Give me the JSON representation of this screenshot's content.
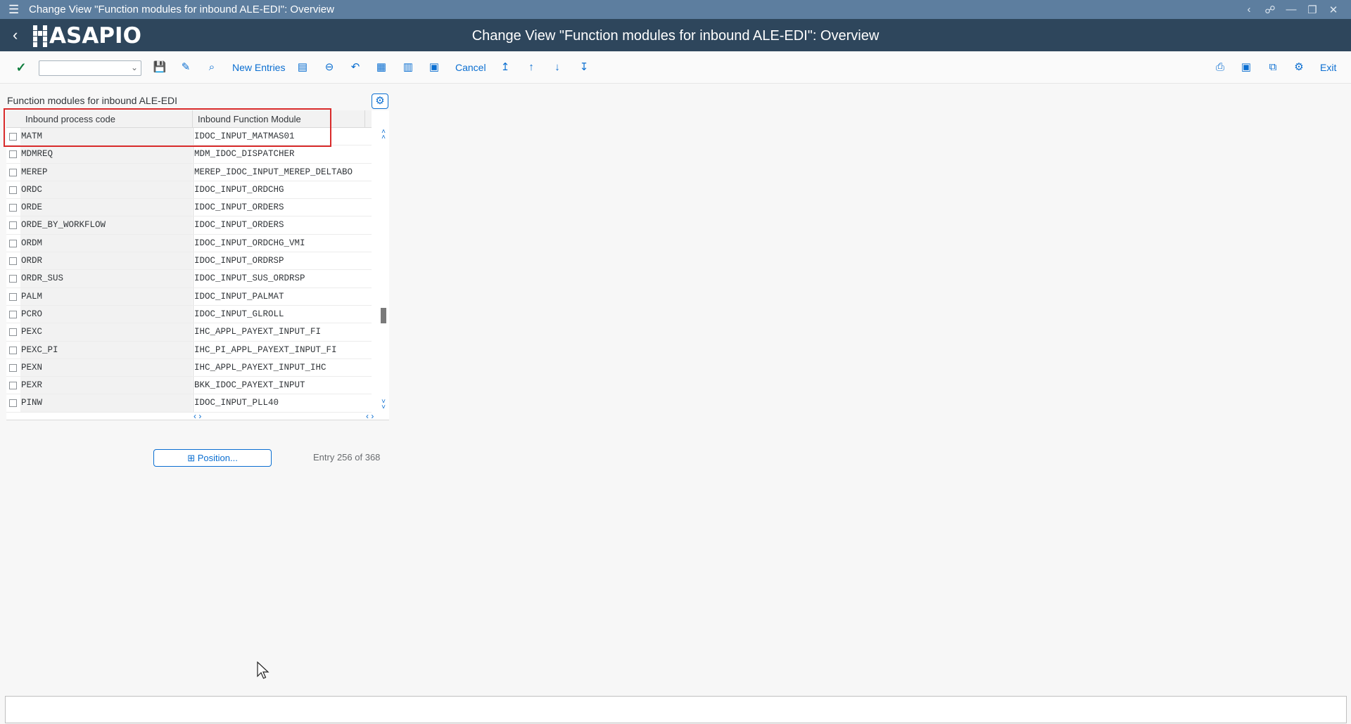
{
  "window": {
    "title": "Change View \"Function modules for inbound ALE-EDI\": Overview"
  },
  "shell": {
    "logo_text": "ASAPIO",
    "title": "Change View \"Function modules for inbound ALE-EDI\": Overview"
  },
  "toolbar": {
    "command_field_value": "",
    "new_entries_label": "New Entries",
    "cancel_label": "Cancel",
    "exit_label": "Exit"
  },
  "section": {
    "title": "Function modules for inbound ALE-EDI"
  },
  "table": {
    "columns": [
      "Inbound process code",
      "Inbound Function Module"
    ],
    "rows": [
      {
        "code": "MATM",
        "module": "IDOC_INPUT_MATMAS01"
      },
      {
        "code": "MDMREQ",
        "module": "MDM_IDOC_DISPATCHER"
      },
      {
        "code": "MEREP",
        "module": "MEREP_IDOC_INPUT_MEREP_DELTABO"
      },
      {
        "code": "ORDC",
        "module": "IDOC_INPUT_ORDCHG"
      },
      {
        "code": "ORDE",
        "module": "IDOC_INPUT_ORDERS"
      },
      {
        "code": "ORDE_BY_WORKFLOW",
        "module": "IDOC_INPUT_ORDERS"
      },
      {
        "code": "ORDM",
        "module": "IDOC_INPUT_ORDCHG_VMI"
      },
      {
        "code": "ORDR",
        "module": "IDOC_INPUT_ORDRSP"
      },
      {
        "code": "ORDR_SUS",
        "module": "IDOC_INPUT_SUS_ORDRSP"
      },
      {
        "code": "PALM",
        "module": "IDOC_INPUT_PALMAT"
      },
      {
        "code": "PCRO",
        "module": "IDOC_INPUT_GLROLL"
      },
      {
        "code": "PEXC",
        "module": "IHC_APPL_PAYEXT_INPUT_FI"
      },
      {
        "code": "PEXC_PI",
        "module": "IHC_PI_APPL_PAYEXT_INPUT_FI"
      },
      {
        "code": "PEXN",
        "module": "IHC_APPL_PAYEXT_INPUT_IHC"
      },
      {
        "code": "PEXR",
        "module": "BKK_IDOC_PAYEXT_INPUT"
      },
      {
        "code": "PINW",
        "module": "IDOC_INPUT_PLL40"
      }
    ],
    "scroll_position_fraction": 0.69
  },
  "footer": {
    "position_button_label": "Position...",
    "entry_info": "Entry 256 of 368"
  },
  "colors": {
    "title_bar": "#5d7e9f",
    "shell_header": "#2e465c",
    "accent": "#0a6ed1",
    "highlight_box": "#d92b2b"
  }
}
